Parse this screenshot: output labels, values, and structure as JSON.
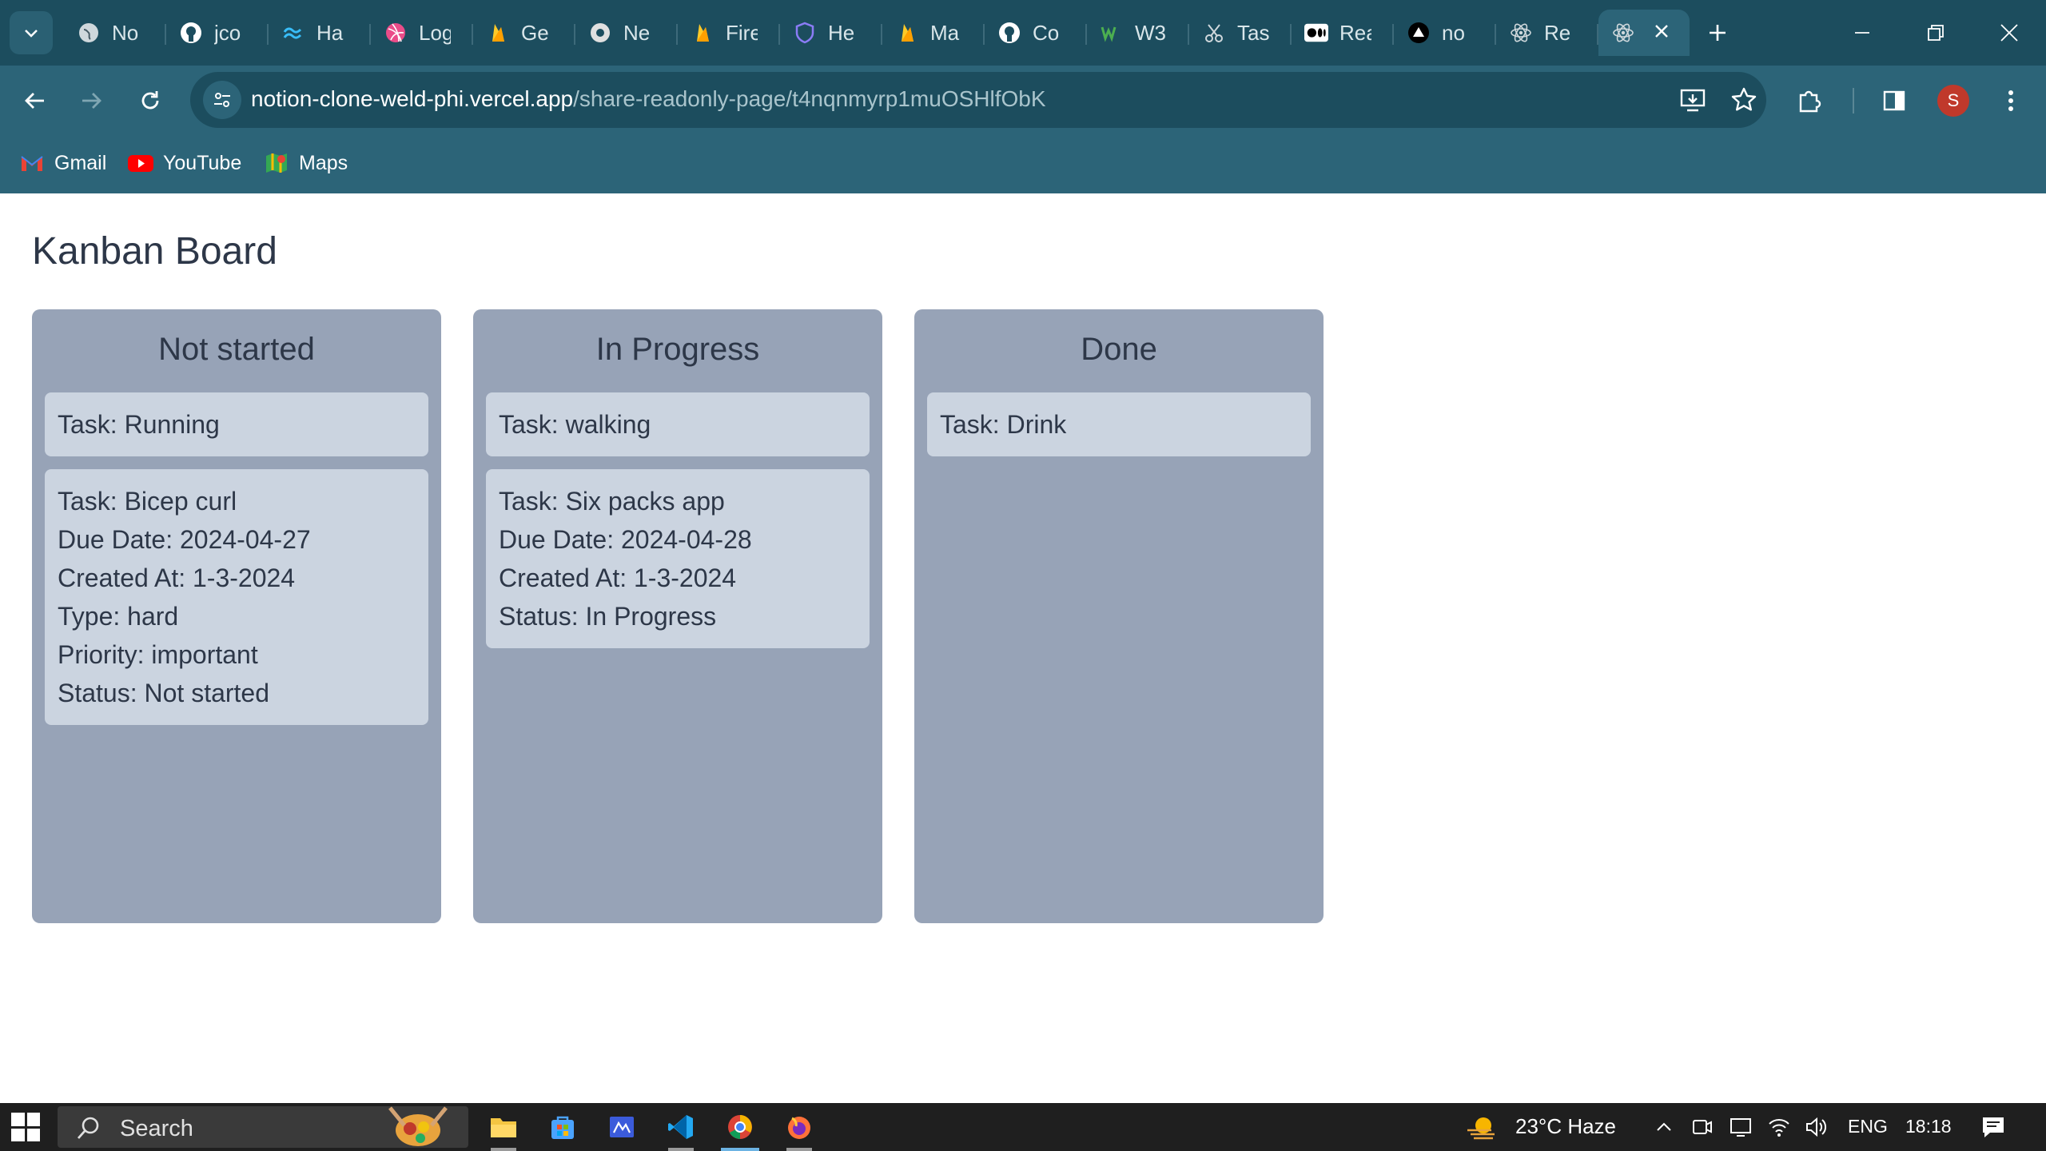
{
  "browser": {
    "tabs": [
      {
        "title": "No",
        "icon": "globe-icon"
      },
      {
        "title": "jco",
        "icon": "github-icon"
      },
      {
        "title": "Ha",
        "icon": "tailwind-icon"
      },
      {
        "title": "Log",
        "icon": "dribbble-icon"
      },
      {
        "title": "Ge",
        "icon": "firebase-icon"
      },
      {
        "title": "Ne",
        "icon": "chrome-icon"
      },
      {
        "title": "Fire",
        "icon": "firebase-icon"
      },
      {
        "title": "He",
        "icon": "shield-icon"
      },
      {
        "title": "Ma",
        "icon": "firebase-icon"
      },
      {
        "title": "Co",
        "icon": "github-icon"
      },
      {
        "title": "W3",
        "icon": "w3-icon"
      },
      {
        "title": "Tas",
        "icon": "scissors-icon"
      },
      {
        "title": "Rea",
        "icon": "medium-icon"
      },
      {
        "title": "no",
        "icon": "vercel-icon"
      },
      {
        "title": "Re",
        "icon": "react-icon"
      }
    ],
    "address": {
      "domain": "notion-clone-weld-phi.vercel.app",
      "path": "/share-readonly-page/t4nqnmyrp1muOSHlfObK"
    },
    "profile_initial": "S",
    "bookmarks": [
      {
        "label": "Gmail",
        "icon": "gmail-icon"
      },
      {
        "label": "YouTube",
        "icon": "youtube-icon"
      },
      {
        "label": "Maps",
        "icon": "maps-icon"
      }
    ]
  },
  "page": {
    "title": "Kanban Board",
    "columns": [
      {
        "title": "Not started",
        "cards": [
          {
            "lines": [
              "Task: Running"
            ]
          },
          {
            "lines": [
              "Task: Bicep curl",
              "Due Date: 2024-04-27",
              "Created At: 1-3-2024",
              "Type: hard",
              "Priority: important",
              "Status: Not started"
            ]
          }
        ]
      },
      {
        "title": "In Progress",
        "cards": [
          {
            "lines": [
              "Task: walking"
            ]
          },
          {
            "lines": [
              "Task: Six packs app",
              "Due Date: 2024-04-28",
              "Created At: 1-3-2024",
              "Status: In Progress"
            ]
          }
        ]
      },
      {
        "title": "Done",
        "cards": [
          {
            "lines": [
              "Task: Drink"
            ]
          }
        ]
      }
    ]
  },
  "taskbar": {
    "search_label": "Search",
    "weather": "23°C  Haze",
    "language": "ENG",
    "time": "18:18"
  },
  "colors": {
    "chrome_dark": "#1c4d5e",
    "chrome": "#2c6478",
    "column_bg": "#97a3b7",
    "card_bg": "#cbd4e0",
    "text": "#2d3748"
  }
}
